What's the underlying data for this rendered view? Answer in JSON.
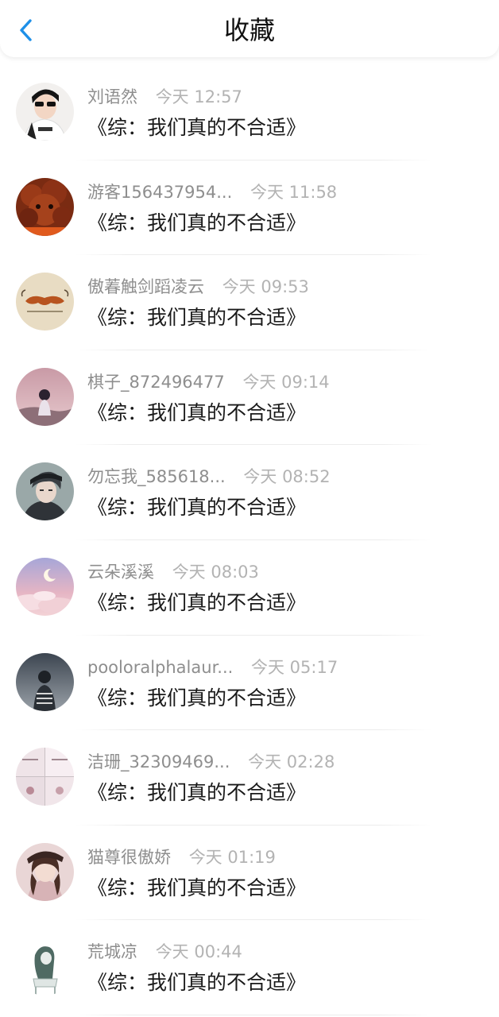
{
  "header": {
    "title": "收藏",
    "back_icon": "chevron-left-icon",
    "accent_color": "#1e90e8"
  },
  "items": [
    {
      "name": "刘语然",
      "time": "今天 12:57",
      "content": "《综：我们真的不合适》"
    },
    {
      "name": "游客156437954...",
      "time": "今天 11:58",
      "content": "《综：我们真的不合适》"
    },
    {
      "name": "傲萶触剑蹈凌云",
      "time": "今天 09:53",
      "content": "《综：我们真的不合适》"
    },
    {
      "name": "棋子_872496477",
      "time": "今天 09:14",
      "content": "《综：我们真的不合适》"
    },
    {
      "name": "勿忘我_585618...",
      "time": "今天 08:52",
      "content": "《综：我们真的不合适》"
    },
    {
      "name": "云朵溪溪",
      "time": "今天 08:03",
      "content": "《综：我们真的不合适》"
    },
    {
      "name": "pooloralphalaur...",
      "time": "今天 05:17",
      "content": "《综：我们真的不合适》"
    },
    {
      "name": "洁珊_32309469...",
      "time": "今天 02:28",
      "content": "《综：我们真的不合适》"
    },
    {
      "name": "猫尊很傲娇",
      "time": "今天 01:19",
      "content": "《综：我们真的不合适》"
    },
    {
      "name": "荒城凉",
      "time": "今天 00:44",
      "content": "《综：我们真的不合适》"
    }
  ]
}
